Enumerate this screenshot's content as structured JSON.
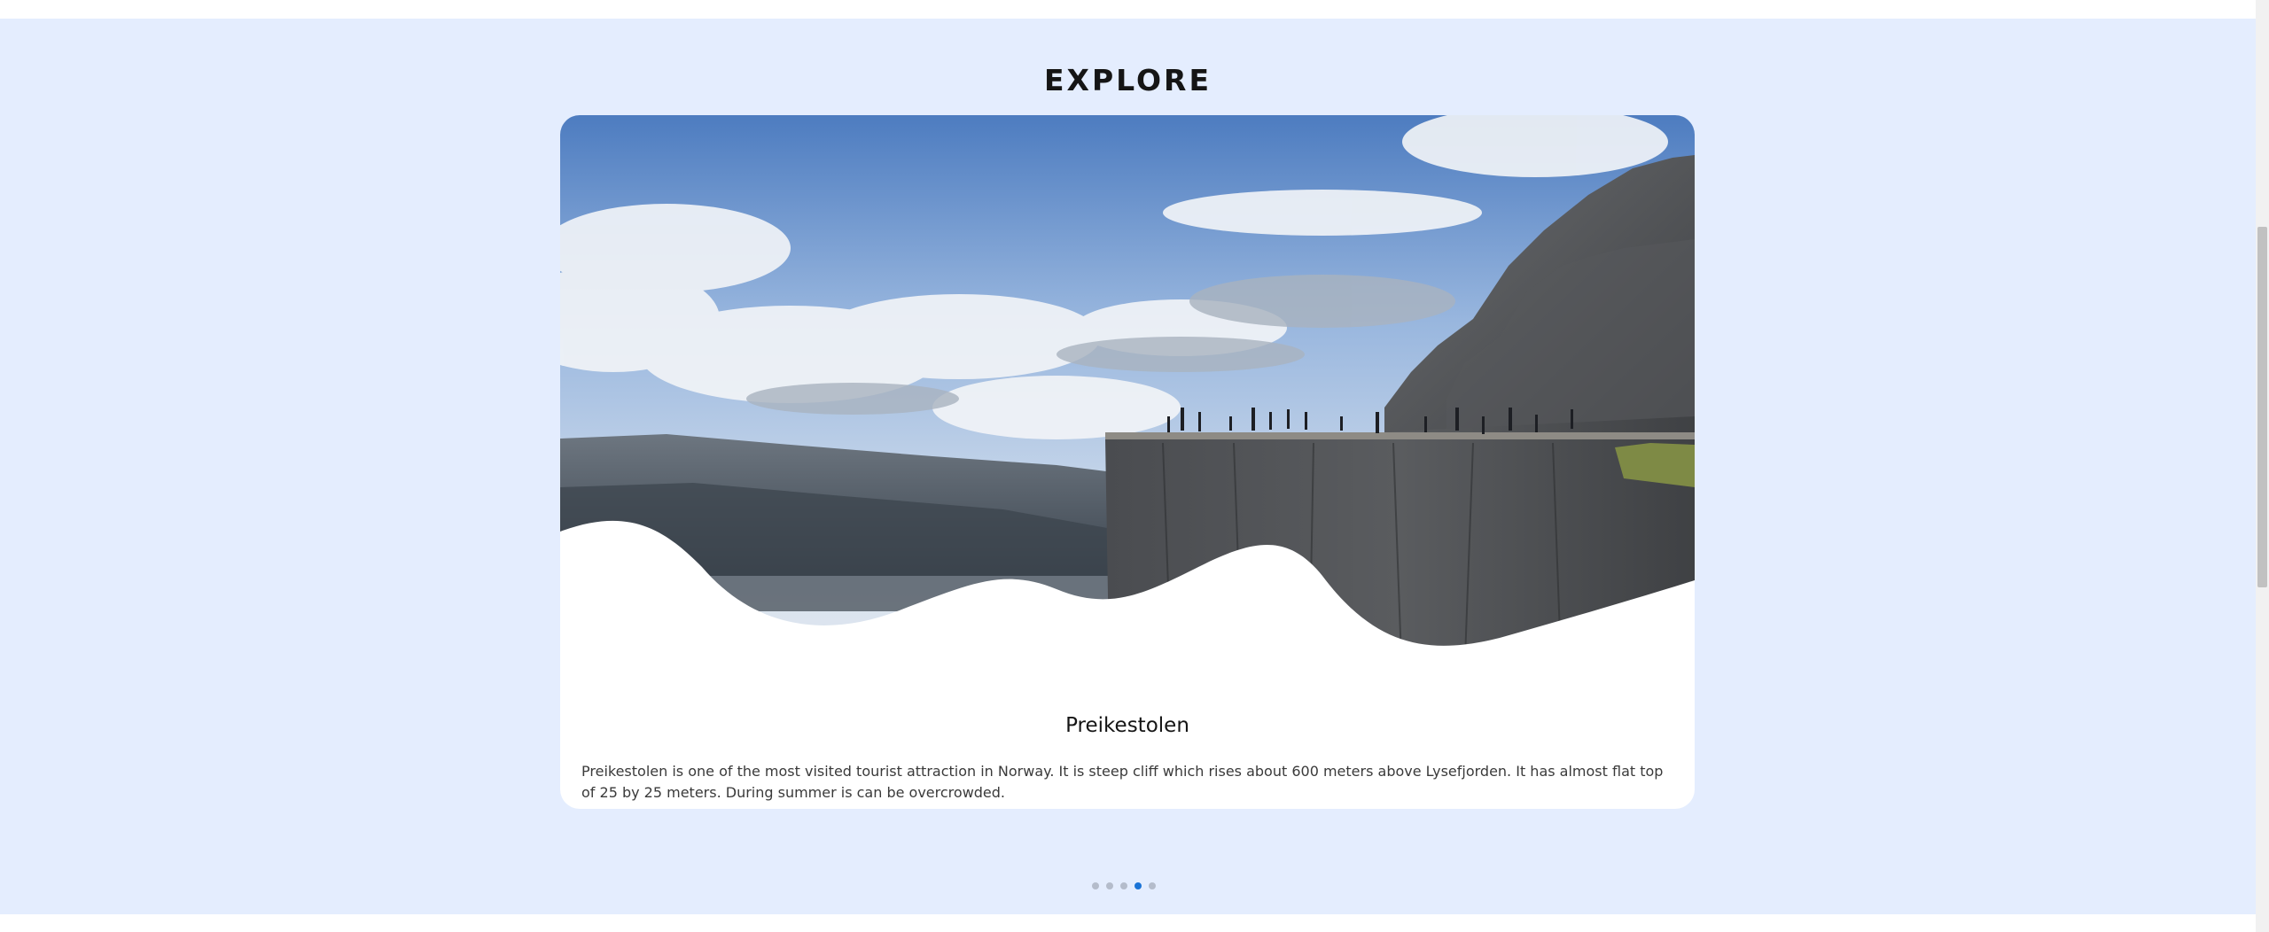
{
  "explore": {
    "title": "EXPLORE"
  },
  "slide": {
    "title": "Preikestolen",
    "description": "Preikestolen is one of the most visited tourist attraction in Norway. It is steep cliff which rises about 600 meters above Lysefjorden. It has almost flat top of 25 by 25 meters. During summer is can be overcrowded.",
    "image_icon": "mountain-cliff-photo"
  },
  "carousel": {
    "dot_count": 5,
    "active_index": 3
  },
  "colors": {
    "section_background": "#e4edfe",
    "card_background": "#ffffff",
    "dot_inactive": "#b4bccb",
    "dot_active": "#1a73d6"
  }
}
